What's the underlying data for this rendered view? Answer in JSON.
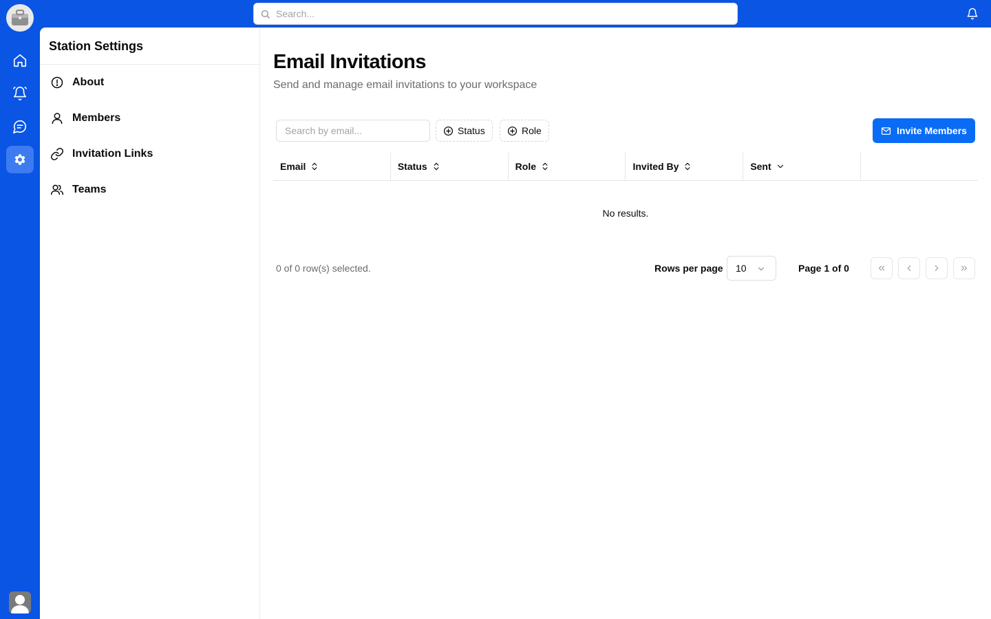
{
  "topbar": {
    "search_placeholder": "Search..."
  },
  "rail": {
    "items": [
      {
        "icon": "home-icon",
        "label": "Home"
      },
      {
        "icon": "bell-icon",
        "label": "Notifications"
      },
      {
        "icon": "chat-icon",
        "label": "Messages"
      },
      {
        "icon": "gear-icon",
        "label": "Settings",
        "active": true
      }
    ]
  },
  "settings": {
    "title": "Station Settings",
    "nav": [
      {
        "label": "About",
        "icon": "info-icon"
      },
      {
        "label": "Members",
        "icon": "user-icon"
      },
      {
        "label": "Invitation Links",
        "icon": "link-icon"
      },
      {
        "label": "Teams",
        "icon": "users-icon"
      }
    ]
  },
  "main": {
    "title": "Email Invitations",
    "subtitle": "Send and manage email invitations to your workspace",
    "filter_placeholder": "Search by email...",
    "facets": {
      "status": "Status",
      "role": "Role"
    },
    "invite_label": "Invite Members",
    "table": {
      "columns": [
        "Email",
        "Status",
        "Role",
        "Invited By",
        "Sent"
      ],
      "empty_text": "No results."
    },
    "footer": {
      "selected_text": "0 of 0 row(s) selected.",
      "rows_per_page_label": "Rows per page",
      "rows_per_page_value": "10",
      "page_indicator": "Page 1 of 0"
    }
  },
  "colors": {
    "brand": "#0a55e3",
    "primary_button": "#0a6cf5",
    "active_rail": "#3d7cf0"
  }
}
